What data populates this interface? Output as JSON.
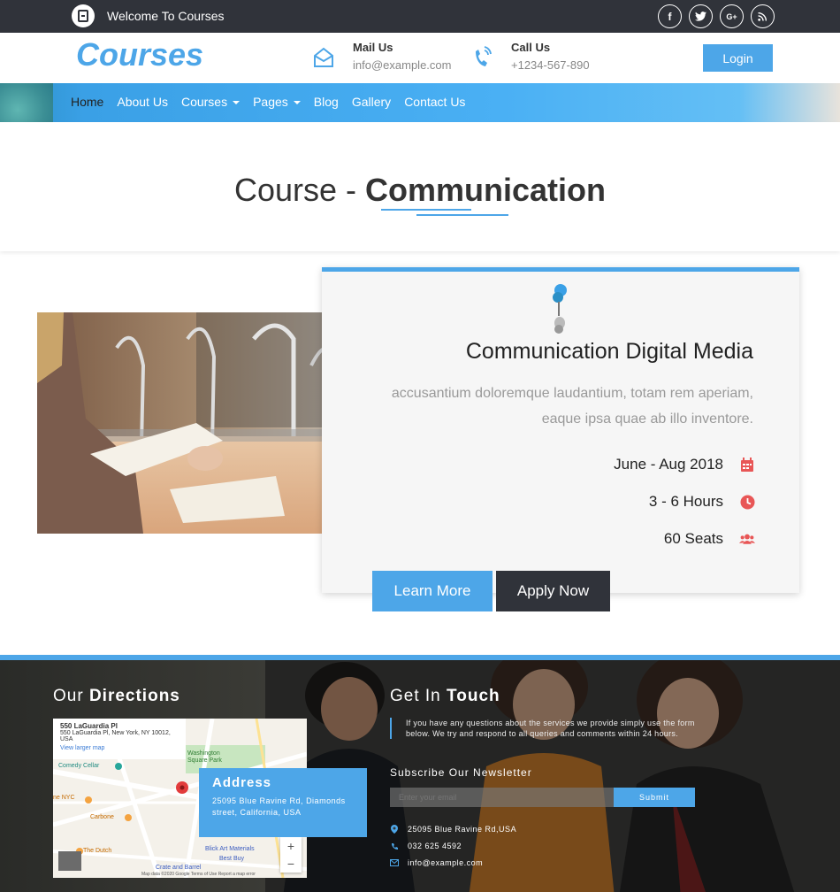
{
  "topbar": {
    "welcome": "Welcome To Courses",
    "socials": [
      {
        "icon": "facebook-icon",
        "glyph": "f"
      },
      {
        "icon": "twitter-icon",
        "glyph": "t"
      },
      {
        "icon": "google-plus-icon",
        "glyph": "G+"
      },
      {
        "icon": "rss-icon",
        "glyph": "◔"
      }
    ]
  },
  "header": {
    "brand": "Courses",
    "mail_title": "Mail Us",
    "mail_value": "info@example.com",
    "call_title": "Call Us",
    "call_value": "+1234-567-890",
    "login": "Login"
  },
  "nav": {
    "items": [
      {
        "label": "Home",
        "active": true,
        "dropdown": false
      },
      {
        "label": "About Us",
        "active": false,
        "dropdown": false
      },
      {
        "label": "Courses",
        "active": false,
        "dropdown": true
      },
      {
        "label": "Pages",
        "active": false,
        "dropdown": true
      },
      {
        "label": "Blog",
        "active": false,
        "dropdown": false
      },
      {
        "label": "Gallery",
        "active": false,
        "dropdown": false
      },
      {
        "label": "Contact Us",
        "active": false,
        "dropdown": false
      }
    ]
  },
  "page": {
    "title_prefix": "Course - ",
    "title_bold": "Communication"
  },
  "course": {
    "name": "Communication Digital Media",
    "description": "accusantium doloremque laudantium, totam rem aperiam, eaque ipsa quae ab illo inventore.",
    "dates": "June - Aug 2018",
    "hours": "3 - 6 Hours",
    "seats": "60 Seats",
    "learn_more": "Learn More",
    "apply_now": "Apply Now"
  },
  "footer": {
    "directions_prefix": "Our ",
    "directions_bold": "Directions",
    "map": {
      "place": "550 LaGuardia Pl",
      "place_address": "550 LaGuardia Pl, New York, NY 10012, USA",
      "larger_map": "View larger map",
      "labels": [
        "Comedy Cellar",
        "Washington Square Park",
        "Carbone",
        "The Dutch",
        "Blick Art Materials",
        "Best Buy",
        "Crate and Barrel",
        "ne NYC"
      ],
      "attribution": "Map data ©2020 Google   Terms of Use   Report a map error"
    },
    "address_title": "Address",
    "address_value": "25095 Blue Ravine Rd, Diamonds street, California, USA",
    "touch_prefix": "Get In ",
    "touch_bold": "Touch",
    "touch_text": "If you have any questions about the services we provide simply use the form below. We try and respond to all queries and comments within 24 hours.",
    "newsletter_title": "Subscribe Our Newsletter",
    "email_placeholder": "Enter your email",
    "submit": "Submit",
    "contact_address": "25095 Blue Ravine Rd,USA",
    "contact_phone": "032 625 4592",
    "contact_email": "info@example.com"
  },
  "colors": {
    "accent": "#4da6e8",
    "dark": "#30333a",
    "alert": "#e85656"
  }
}
